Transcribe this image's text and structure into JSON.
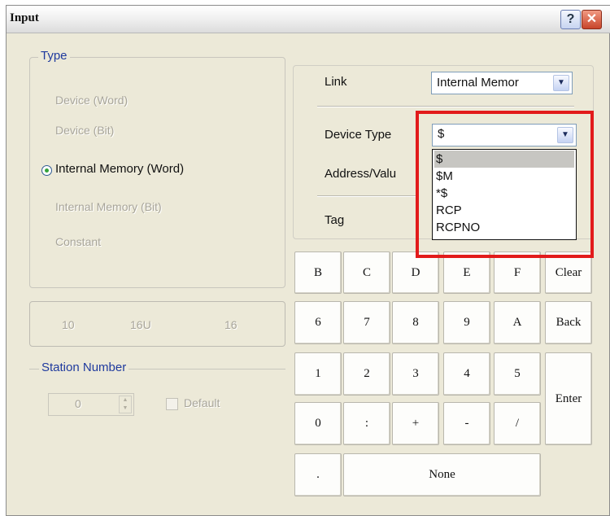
{
  "window": {
    "title": "Input",
    "help_label": "?",
    "close_label": "✕"
  },
  "type_group": {
    "legend": "Type",
    "options": [
      {
        "label": "Device (Word)",
        "enabled": false
      },
      {
        "label": "Device (Bit)",
        "enabled": false
      },
      {
        "label": "Internal Memory (Word)",
        "enabled": true,
        "selected": true
      },
      {
        "label": "Internal Memory (Bit)",
        "enabled": false
      },
      {
        "label": "Constant",
        "enabled": false
      }
    ]
  },
  "radix_group": {
    "options": [
      "10",
      "16U",
      "16"
    ]
  },
  "station_group": {
    "legend": "Station Number",
    "value": "0",
    "default_label": "Default"
  },
  "link": {
    "label": "Link",
    "value": "Internal Memor"
  },
  "device_type": {
    "label": "Device Type",
    "value": "$",
    "options": [
      "$",
      "$M",
      "*$",
      "RCP",
      "RCPNO"
    ],
    "highlighted_index": 0
  },
  "address": {
    "label": "Address/Valu"
  },
  "tag": {
    "label": "Tag"
  },
  "keypad": {
    "row1": [
      "B",
      "C",
      "D",
      "E",
      "F",
      "Clear"
    ],
    "row2": [
      "6",
      "7",
      "8",
      "9",
      "A",
      "Back"
    ],
    "row3": [
      "1",
      "2",
      "3",
      "4",
      "5"
    ],
    "row4": [
      "0",
      ":",
      "+",
      "-",
      "/"
    ],
    "enter": "Enter",
    "dot": ".",
    "none": "None"
  },
  "colors": {
    "highlight_box": "#e21b1b",
    "legend_text": "#1f3a9e",
    "window_bg": "#ece9d8"
  },
  "icons": {
    "help": "question-icon",
    "close": "close-icon",
    "combo_arrow": "chevron-down-icon",
    "spinner": "spinner-arrows-icon",
    "radio": "radio-icon",
    "checkbox": "checkbox-icon"
  }
}
